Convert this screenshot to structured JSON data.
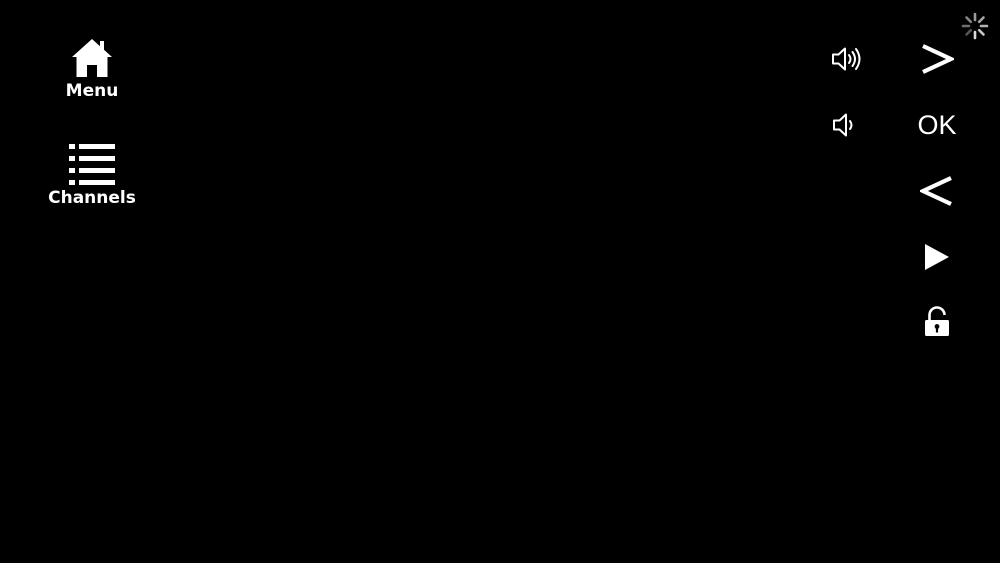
{
  "nav": {
    "menu": {
      "label": "Menu",
      "icon": "home-icon"
    },
    "channels": {
      "label": "Channels",
      "icon": "list-icon"
    }
  },
  "controls": {
    "volume_up": {
      "icon": "volume-up-icon"
    },
    "volume_down": {
      "icon": "volume-down-icon"
    },
    "next": {
      "icon": "chevron-right-icon"
    },
    "ok": {
      "label": "OK"
    },
    "previous": {
      "icon": "chevron-left-icon"
    },
    "play": {
      "icon": "play-icon"
    },
    "lock": {
      "icon": "unlock-icon"
    }
  },
  "status": {
    "icon": "loading-spinner-icon"
  },
  "colors": {
    "background": "#000000",
    "foreground": "#ffffff"
  }
}
